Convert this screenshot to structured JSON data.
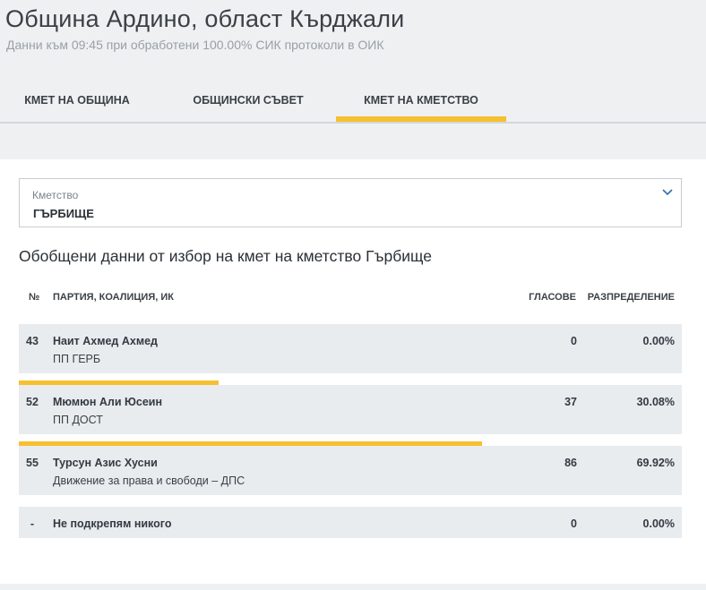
{
  "header": {
    "title": "Община Ардино, област Кърджали",
    "subtitle": "Данни към 09:45 при обработени 100.00% СИК протоколи в ОИК"
  },
  "tabs": [
    {
      "label": "КМЕТ НА ОБЩИНА",
      "active": false
    },
    {
      "label": "ОБЩИНСКИ СЪВЕТ",
      "active": false
    },
    {
      "label": "КМЕТ НА КМЕТСТВО",
      "active": true
    }
  ],
  "select": {
    "label": "Кметство",
    "value": "ГЪРБИЩЕ",
    "icon": "chevron-down-icon"
  },
  "section_title": "Обобщени данни от избор на кмет на кметство Гърбище",
  "table": {
    "headers": {
      "num": "№",
      "party": "ПАРТИЯ, КОАЛИЦИЯ, ИК",
      "votes": "ГЛАСОВЕ",
      "distribution": "РАЗПРЕДЕЛЕНИЕ"
    },
    "rows": [
      {
        "num": "43",
        "name": "Наит Ахмед Ахмед",
        "party": "ПП ГЕРБ",
        "votes": "0",
        "pct": "0.00%"
      },
      {
        "num": "52",
        "name": "Мюмюн Али Юсеин",
        "party": "ПП ДОСТ",
        "votes": "37",
        "pct": "30.08%"
      },
      {
        "num": "55",
        "name": "Турсун Азис Хусни",
        "party": "Движение за права и свободи – ДПС",
        "votes": "86",
        "pct": "69.92%"
      },
      {
        "num": "-",
        "name": "Не подкрепям никого",
        "party": "",
        "votes": "0",
        "pct": "0.00%"
      }
    ],
    "bar_fractions": [
      0.3008,
      0.6992
    ]
  },
  "colors": {
    "accent": "#f6c02e",
    "header_bg": "#eef0f2",
    "row_bg": "#e9ecef"
  }
}
